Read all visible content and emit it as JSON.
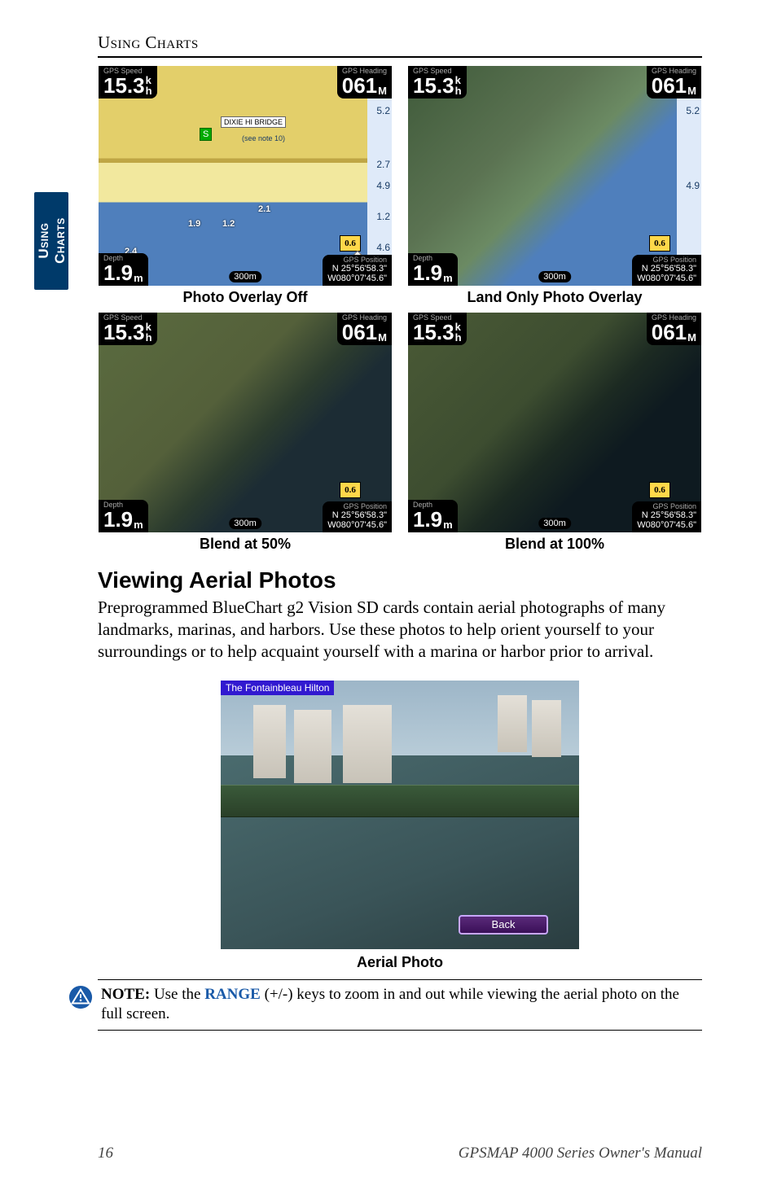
{
  "running_head": "Using Charts",
  "side_tab_line1": "Using",
  "side_tab_line2": "Charts",
  "hud": {
    "speed_label": "GPS Speed",
    "speed_value": "15.3",
    "speed_unit_top": "k",
    "speed_unit_bottom": "h",
    "heading_label": "GPS Heading",
    "heading_value": "061",
    "heading_unit": "M",
    "depth_label": "Depth",
    "depth_value": "1.9",
    "depth_unit": "m",
    "pos_label": "GPS Position",
    "pos_lat": "N  25°56'58.3\"",
    "pos_lon": "W080°07'45.6\"",
    "scale": "300m"
  },
  "right_strip": {
    "d1": "5.2",
    "d2": "2.7",
    "d3": "4.9",
    "d4": "1.2",
    "d5": "4.6"
  },
  "markers": {
    "bridge": "DIXIE HI BRIDGE",
    "note": "(see note 10)",
    "d06": "0.6",
    "d19": "1.9",
    "d12": "1.2",
    "d21": "2.1",
    "d24": "2.4",
    "d46": "4.6",
    "s": "S"
  },
  "captions": {
    "c1": "Photo Overlay Off",
    "c2": "Land Only Photo Overlay",
    "c3": "Blend at 50%",
    "c4": "Blend at 100%"
  },
  "section_heading": "Viewing Aerial Photos",
  "paragraph": "Preprogrammed BlueChart g2 Vision SD cards contain aerial photographs of many landmarks, marinas, and harbors. Use these photos to help orient yourself to your surroundings or to help acquaint yourself with a marina or harbor prior to arrival.",
  "aerial": {
    "title": "The Fontainbleau Hilton",
    "back": "Back",
    "caption": "Aerial Photo"
  },
  "note": {
    "lead": "NOTE:",
    "pre": " Use the ",
    "range": "RANGE",
    "post": " (+/-) keys to zoom in and out while viewing the aerial photo on the full screen."
  },
  "footer": {
    "page": "16",
    "manual": "GPSMAP 4000 Series Owner's Manual"
  }
}
